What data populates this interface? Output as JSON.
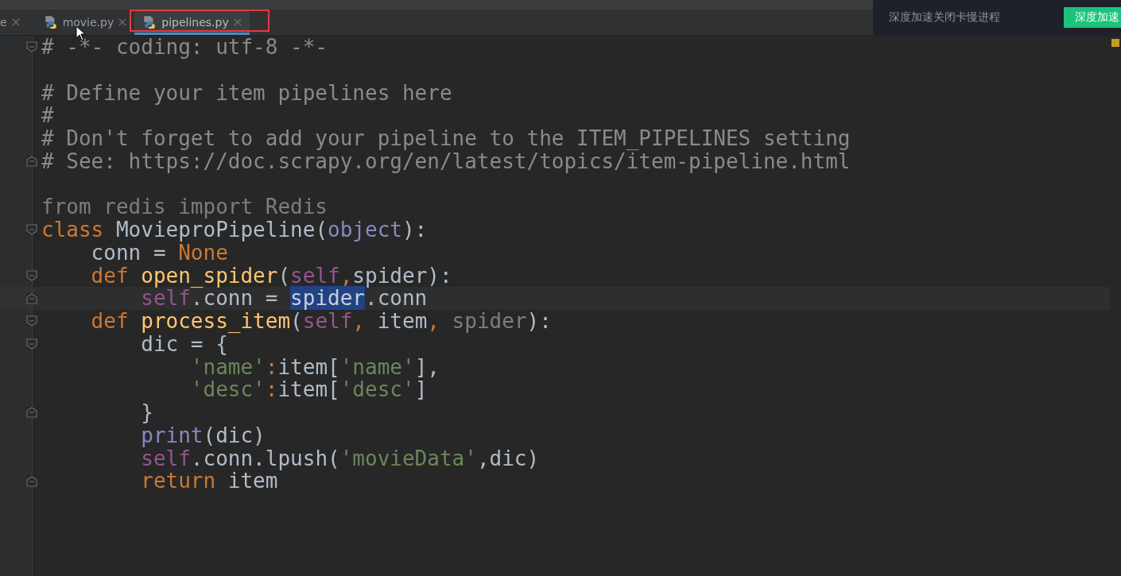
{
  "tabs": [
    {
      "label": "e",
      "selected": false,
      "icon": false
    },
    {
      "label": "movie.py",
      "selected": false,
      "icon": true
    },
    {
      "label": "pipelines.py",
      "selected": true,
      "icon": true,
      "annotated": true
    }
  ],
  "notification": {
    "message": "深度加速关闭卡慢进程",
    "button": "深度加速"
  },
  "editor": {
    "lines": [
      {
        "fold_open": true,
        "tokens": [
          {
            "text": "# -*- coding: utf-8 -*-",
            "kind": "comment"
          }
        ]
      },
      {
        "blank_line_before": true,
        "tokens": [
          {
            "text": "# Define your item pipelines here",
            "kind": "comment"
          }
        ]
      },
      {
        "tokens": [
          {
            "text": "#",
            "kind": "comment"
          }
        ]
      },
      {
        "tokens": [
          {
            "text": "# Don't forget to add your pipeline to the ITEM_PIPELINES setting",
            "kind": "comment"
          }
        ]
      },
      {
        "fold_close": true,
        "tokens": [
          {
            "text": "# See: https://doc.scrapy.org/en/latest/topics/item-pipeline.html",
            "kind": "comment"
          }
        ]
      },
      {
        "blank_line_before": true,
        "tokens": [
          {
            "text": "from redis import Redis",
            "kind": "unused"
          }
        ]
      },
      {
        "fold_open": true,
        "tokens": [
          {
            "text": "class ",
            "kind": "keyword"
          },
          {
            "text": "MovieproPipeline(",
            "kind": "plain"
          },
          {
            "text": "object",
            "kind": "builtin"
          },
          {
            "text": "):",
            "kind": "plain"
          }
        ]
      },
      {
        "tokens": [
          {
            "text": "    conn = ",
            "kind": "plain"
          },
          {
            "text": "None",
            "kind": "keyword"
          }
        ]
      },
      {
        "fold_open": true,
        "tokens": [
          {
            "text": "    def ",
            "kind": "keyword"
          },
          {
            "text": "open_spider",
            "kind": "function"
          },
          {
            "text": "(",
            "kind": "plain"
          },
          {
            "text": "self",
            "kind": "self"
          },
          {
            "text": ",",
            "kind": "keyword"
          },
          {
            "text": "spider",
            "kind": "plain"
          },
          {
            "text": "):",
            "kind": "plain"
          }
        ]
      },
      {
        "fold_close": true,
        "current": true,
        "tokens": [
          {
            "text": "        self",
            "kind": "self"
          },
          {
            "text": ".conn = ",
            "kind": "plain"
          },
          {
            "text": "spider",
            "kind": "selection"
          },
          {
            "text": ".conn",
            "kind": "plain"
          }
        ]
      },
      {
        "fold_open": true,
        "tokens": [
          {
            "text": "    def ",
            "kind": "keyword"
          },
          {
            "text": "process_item",
            "kind": "function"
          },
          {
            "text": "(",
            "kind": "plain"
          },
          {
            "text": "self",
            "kind": "self"
          },
          {
            "text": ", ",
            "kind": "keyword"
          },
          {
            "text": "item",
            "kind": "plain"
          },
          {
            "text": ", ",
            "kind": "keyword"
          },
          {
            "text": "spider",
            "kind": "unused"
          },
          {
            "text": "):",
            "kind": "plain"
          }
        ]
      },
      {
        "fold_open": true,
        "tokens": [
          {
            "text": "        dic = {",
            "kind": "plain"
          }
        ]
      },
      {
        "tokens": [
          {
            "text": "            'name'",
            "kind": "string"
          },
          {
            "text": ":",
            "kind": "keyword"
          },
          {
            "text": "item[",
            "kind": "plain"
          },
          {
            "text": "'name'",
            "kind": "string"
          },
          {
            "text": "],",
            "kind": "plain"
          }
        ]
      },
      {
        "tokens": [
          {
            "text": "            'desc'",
            "kind": "string"
          },
          {
            "text": ":",
            "kind": "keyword"
          },
          {
            "text": "item[",
            "kind": "plain"
          },
          {
            "text": "'desc'",
            "kind": "string"
          },
          {
            "text": "]",
            "kind": "plain"
          }
        ]
      },
      {
        "fold_close": true,
        "tokens": [
          {
            "text": "        }",
            "kind": "plain"
          }
        ]
      },
      {
        "tokens": [
          {
            "text": "        print",
            "kind": "builtin"
          },
          {
            "text": "(dic)",
            "kind": "plain"
          }
        ]
      },
      {
        "tokens": [
          {
            "text": "        self",
            "kind": "self"
          },
          {
            "text": ".conn.lpush(",
            "kind": "plain"
          },
          {
            "text": "'movieData'",
            "kind": "string"
          },
          {
            "text": ",dic)",
            "kind": "plain"
          }
        ]
      },
      {
        "fold_close": true,
        "tokens": [
          {
            "text": "        return ",
            "kind": "keyword"
          },
          {
            "text": "item",
            "kind": "plain"
          }
        ]
      }
    ]
  }
}
